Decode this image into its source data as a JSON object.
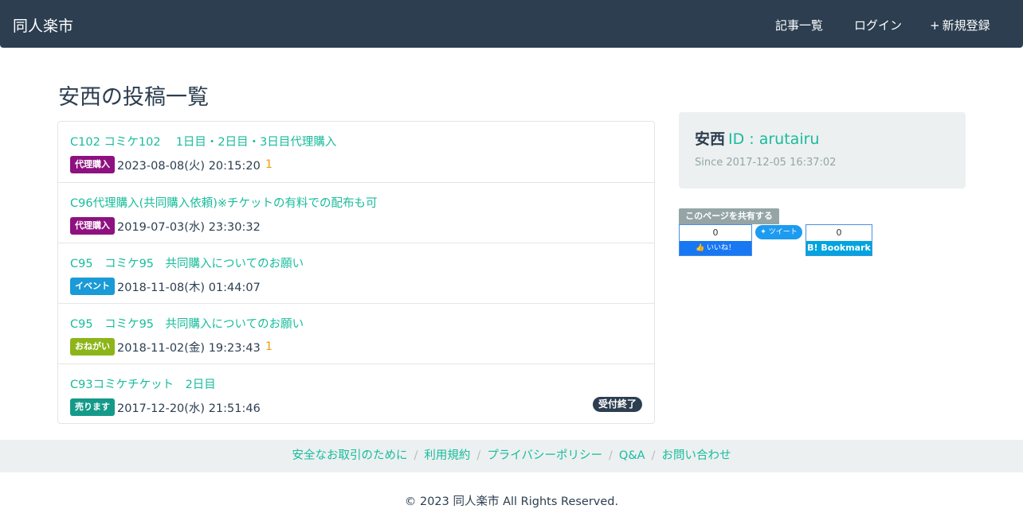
{
  "navbar": {
    "brand": "同人楽市",
    "items": [
      {
        "icon": "",
        "label": "記事一覧"
      },
      {
        "icon": "",
        "label": "ログイン"
      },
      {
        "icon": "+",
        "label": "新規登録"
      }
    ]
  },
  "page_title": "安西の投稿一覧",
  "posts": [
    {
      "title": "C102 コミケ102　 1日目・2日目・3日目代理購入",
      "badge": "代理購入",
      "badge_color": "#8e1180",
      "date": "2023-08-08(火) 20:15:20",
      "comment_icon": "",
      "comments": "1"
    },
    {
      "title": "C96代理購入(共同購入依頼)※チケットの有料での配布も可",
      "badge": "代理購入",
      "badge_color": "#8e1180",
      "date": "2019-07-03(水) 23:30:32"
    },
    {
      "title": "C95　コミケ95　共同購入についてのお願い",
      "badge": "イベント",
      "badge_color": "#1a9ad6",
      "date": "2018-11-08(木) 01:44:07"
    },
    {
      "title": "C95　コミケ95　共同購入についてのお願い",
      "badge": "おねがい",
      "badge_color": "#8db51a",
      "date": "2018-11-02(金) 19:23:43",
      "comment_icon": "",
      "comments": "1"
    },
    {
      "title": "C93コミケチケット　2日目",
      "badge": "売ります",
      "badge_color": "#159a8a",
      "date": "2017-12-20(水) 21:51:46",
      "status": "受付終了"
    }
  ],
  "profile": {
    "icon": "",
    "name": "安西",
    "id_text": "ID : arutairu",
    "since_icon": "",
    "since": "Since 2017-12-05 16:37:02"
  },
  "share": {
    "label": "このページを共有する",
    "facebook_count": "0",
    "facebook_button": "いいね！",
    "twitter_button": "ツイート",
    "hatena_count": "0",
    "hatena_button": "B! Bookmark"
  },
  "footer": {
    "links": [
      "安全なお取引のために",
      "利用規約",
      "プライバシーポリシー",
      "Q&A",
      "お問い合わせ"
    ],
    "separator": "/",
    "copyright": "© 2023 同人楽市 All Rights Reserved."
  }
}
